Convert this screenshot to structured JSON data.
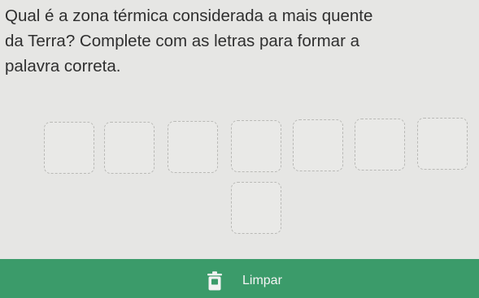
{
  "question": {
    "line1": "Qual é a zona térmica considerada a mais quente",
    "line2": "da Terra? Complete com as letras para formar a",
    "line3": "palavra correta."
  },
  "answer_boxes": {
    "count": 8,
    "letters": [
      "",
      "",
      "",
      "",
      "",
      "",
      "",
      ""
    ]
  },
  "actions": {
    "clear_label": "Limpar",
    "clear_icon": "trash-icon"
  },
  "colors": {
    "background": "#e6e6e4",
    "action_bar": "#3b9b6a",
    "box_border": "#b9b9b6"
  }
}
